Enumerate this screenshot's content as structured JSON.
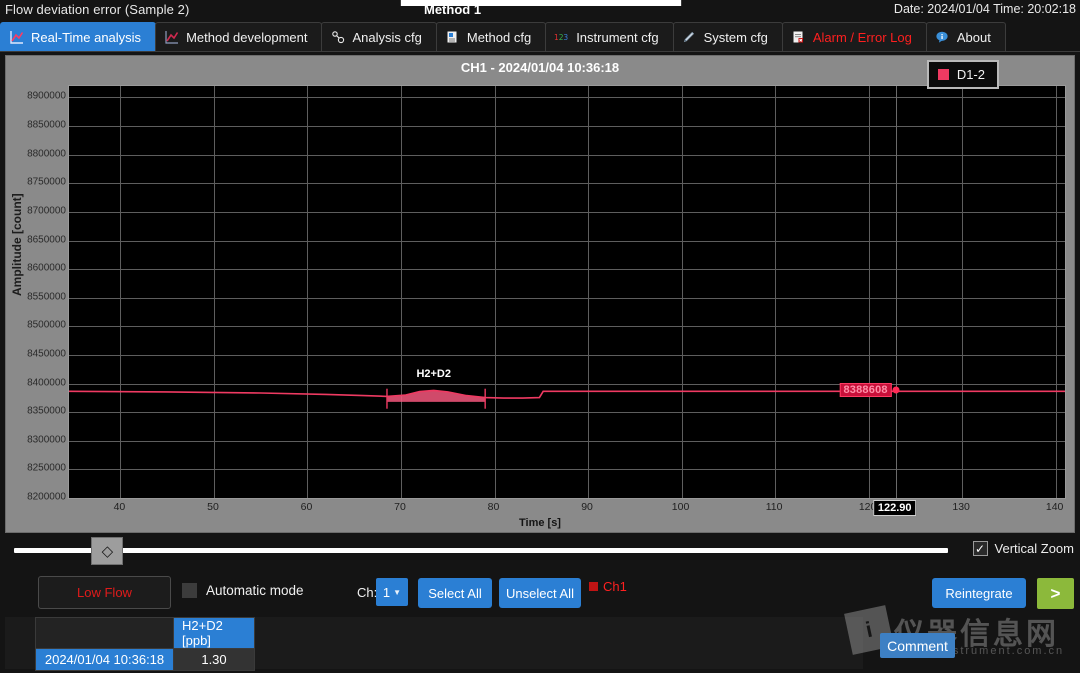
{
  "topbar": {
    "left_text": "Flow deviation error (Sample 2)",
    "center_text": "Method 1",
    "right_text": "Date: 2024/01/04 Time: 20:02:18"
  },
  "tabs": [
    {
      "label": "Real-Time analysis",
      "icon": "line-chart-icon",
      "active": true,
      "alarm": false
    },
    {
      "label": "Method development",
      "icon": "line-chart-icon",
      "active": false,
      "alarm": false
    },
    {
      "label": "Analysis cfg",
      "icon": "molecule-icon",
      "active": false,
      "alarm": false
    },
    {
      "label": "Method cfg",
      "icon": "document-icon",
      "active": false,
      "alarm": false
    },
    {
      "label": "Instrument cfg",
      "icon": "numbers-icon",
      "active": false,
      "alarm": false
    },
    {
      "label": "System cfg",
      "icon": "pen-icon",
      "active": false,
      "alarm": false
    },
    {
      "label": "Alarm / Error Log",
      "icon": "error-page-icon",
      "active": false,
      "alarm": true
    },
    {
      "label": "About",
      "icon": "info-bubble-icon",
      "active": false,
      "alarm": false
    }
  ],
  "chart": {
    "title": "CH1 - 2024/01/04 10:36:18",
    "legend": [
      {
        "label": "D1-2",
        "color": "#ef3a62"
      }
    ],
    "peak_label": "H2+D2",
    "value_flag": "8388608",
    "x_cursor_label": "122.90"
  },
  "chart_data": {
    "type": "line",
    "title": "CH1 - 2024/01/04 10:36:18",
    "xlabel": "Time [s]",
    "ylabel": "Amplitude [count]",
    "xlim": [
      34.5,
      141.0
    ],
    "ylim": [
      8200000,
      8920000
    ],
    "xticks": [
      40,
      50,
      60,
      70,
      80,
      90,
      100,
      110,
      120,
      130,
      140
    ],
    "yticks": [
      8200000,
      8250000,
      8300000,
      8350000,
      8400000,
      8450000,
      8500000,
      8550000,
      8600000,
      8650000,
      8700000,
      8750000,
      8800000,
      8850000,
      8900000
    ],
    "grid": true,
    "legend_position": "top-right",
    "cursor_x": 122.9,
    "cursor_y": 8388608,
    "series": [
      {
        "name": "D1-2",
        "color": "#ef3a62",
        "fill_color": "#f4577c",
        "x": [
          34.5,
          45,
          55,
          62,
          66,
          68.5,
          70.5,
          72,
          73.5,
          75,
          77,
          79,
          81,
          83,
          84.8,
          85.2,
          90,
          100,
          110,
          120,
          130,
          141
        ],
        "y": [
          8386500,
          8385500,
          8383500,
          8381000,
          8379000,
          8377500,
          8380000,
          8386000,
          8388000,
          8385500,
          8379000,
          8375500,
          8374500,
          8374500,
          8375500,
          8386500,
          8386500,
          8386500,
          8386500,
          8386500,
          8386500,
          8386500
        ]
      }
    ],
    "peak": {
      "label": "H2+D2",
      "start_x": 68.5,
      "end_x": 79.0,
      "apex_x": 73.5,
      "apex_y": 8388000,
      "baseline_y": 8377000,
      "filled": true
    },
    "annotations": [
      {
        "text": "8388608",
        "x": 122.9,
        "y": 8388608,
        "style": "value-flag"
      },
      {
        "text": "122.90",
        "x": 122.9,
        "style": "x-axis-cursor"
      }
    ]
  },
  "slider": {
    "thumb_glyph": "‹›",
    "position_percent": 10
  },
  "vertical_zoom": {
    "label": "Vertical Zoom",
    "checked": true,
    "check_glyph": "✓"
  },
  "controls": {
    "low_flow_label": "Low Flow",
    "automatic_mode": {
      "label": "Automatic mode",
      "checked": false
    },
    "ch_label": "Ch:",
    "ch_value": "1",
    "select_all_label": "Select All",
    "unselect_all_label": "Unselect All",
    "ch1_label": "Ch1",
    "ch1_checked": true,
    "reintegrate_label": "Reintegrate",
    "next_label": ">"
  },
  "table": {
    "header_blank": "",
    "columns": [
      "H2+D2 [ppb]"
    ],
    "rows": [
      {
        "time": "2024/01/04 10:36:18",
        "values": [
          "1.30"
        ]
      }
    ]
  },
  "comment_button": {
    "label": "Comment"
  },
  "watermark": {
    "cn": "仪器信息网",
    "en": "www.instrument.com.cn",
    "mark": "i"
  }
}
